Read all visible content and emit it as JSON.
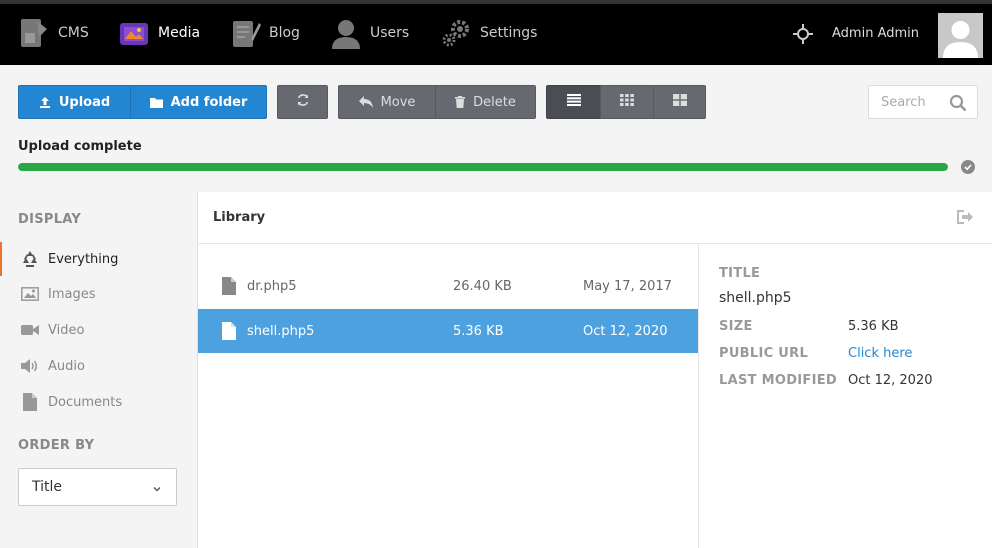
{
  "nav": {
    "items": [
      {
        "label": "CMS",
        "icon": "cms-icon",
        "active": false
      },
      {
        "label": "Media",
        "icon": "media-icon",
        "active": true
      },
      {
        "label": "Blog",
        "icon": "blog-icon",
        "active": false
      },
      {
        "label": "Users",
        "icon": "users-icon",
        "active": false
      },
      {
        "label": "Settings",
        "icon": "settings-icon",
        "active": false
      }
    ],
    "user_name": "Admin Admin"
  },
  "toolbar": {
    "upload_label": "Upload",
    "add_folder_label": "Add folder",
    "move_label": "Move",
    "delete_label": "Delete",
    "search_placeholder": "Search",
    "upload_status": "Upload complete",
    "upload_progress_percent": 100
  },
  "sidebar": {
    "display_heading": "DISPLAY",
    "items": [
      {
        "label": "Everything",
        "icon": "recycle-icon"
      },
      {
        "label": "Images",
        "icon": "image-icon"
      },
      {
        "label": "Video",
        "icon": "video-icon"
      },
      {
        "label": "Audio",
        "icon": "audio-icon"
      },
      {
        "label": "Documents",
        "icon": "document-icon"
      }
    ],
    "order_heading": "ORDER BY",
    "order_value": "Title"
  },
  "library": {
    "title": "Library",
    "files": [
      {
        "name": "dr.php5",
        "size": "26.40 KB",
        "date": "May 17, 2017"
      },
      {
        "name": "shell.php5",
        "size": "5.36 KB",
        "date": "Oct 12, 2020"
      }
    ]
  },
  "detail": {
    "title_label": "TITLE",
    "title_value": "shell.php5",
    "size_label": "SIZE",
    "size_value": "5.36 KB",
    "url_label": "PUBLIC URL",
    "url_value": "Click here",
    "modified_label": "LAST MODIFIED",
    "modified_value": "Oct 12, 2020"
  },
  "colors": {
    "accent": "#2386d2",
    "selected_row": "#4ea1df",
    "progress": "#28a745",
    "active_marker": "#e8742e"
  }
}
